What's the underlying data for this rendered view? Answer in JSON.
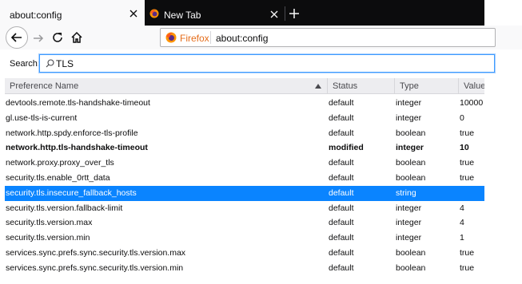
{
  "tabs": [
    {
      "title": "about:config",
      "active": true
    },
    {
      "title": "New Tab",
      "active": false
    }
  ],
  "urlbar": {
    "identity_label": "Firefox",
    "url": "about:config"
  },
  "search": {
    "label": "Search:",
    "value": "TLS"
  },
  "table": {
    "columns": [
      "Preference Name",
      "Status",
      "Type",
      "Value"
    ],
    "sort": {
      "column": "Preference Name",
      "direction": "ascending"
    },
    "rows": [
      {
        "name": "devtools.remote.tls-handshake-timeout",
        "status": "default",
        "type": "integer",
        "value": "10000"
      },
      {
        "name": "gl.use-tls-is-current",
        "status": "default",
        "type": "integer",
        "value": "0"
      },
      {
        "name": "network.http.spdy.enforce-tls-profile",
        "status": "default",
        "type": "boolean",
        "value": "true"
      },
      {
        "name": "network.http.tls-handshake-timeout",
        "status": "modified",
        "type": "integer",
        "value": "10"
      },
      {
        "name": "network.proxy.proxy_over_tls",
        "status": "default",
        "type": "boolean",
        "value": "true"
      },
      {
        "name": "security.tls.enable_0rtt_data",
        "status": "default",
        "type": "boolean",
        "value": "true"
      },
      {
        "name": "security.tls.insecure_fallback_hosts",
        "status": "default",
        "type": "string",
        "value": ""
      },
      {
        "name": "security.tls.version.fallback-limit",
        "status": "default",
        "type": "integer",
        "value": "4"
      },
      {
        "name": "security.tls.version.max",
        "status": "default",
        "type": "integer",
        "value": "4"
      },
      {
        "name": "security.tls.version.min",
        "status": "default",
        "type": "integer",
        "value": "1"
      },
      {
        "name": "services.sync.prefs.sync.security.tls.version.max",
        "status": "default",
        "type": "boolean",
        "value": "true"
      },
      {
        "name": "services.sync.prefs.sync.security.tls.version.min",
        "status": "default",
        "type": "boolean",
        "value": "true"
      }
    ],
    "selected_row": "security.tls.insecure_fallback_hosts"
  },
  "colors": {
    "selection": "#0a84ff",
    "tabstrip": "#0c0c0d",
    "identity": "#e56d1b",
    "focus_ring": "#3e9bff"
  },
  "icons": [
    "close-icon",
    "firefox-logo-icon",
    "plus-icon",
    "back-arrow-icon",
    "forward-arrow-icon",
    "reload-icon",
    "home-icon",
    "magnifier-icon",
    "sort-ascending-icon"
  ]
}
